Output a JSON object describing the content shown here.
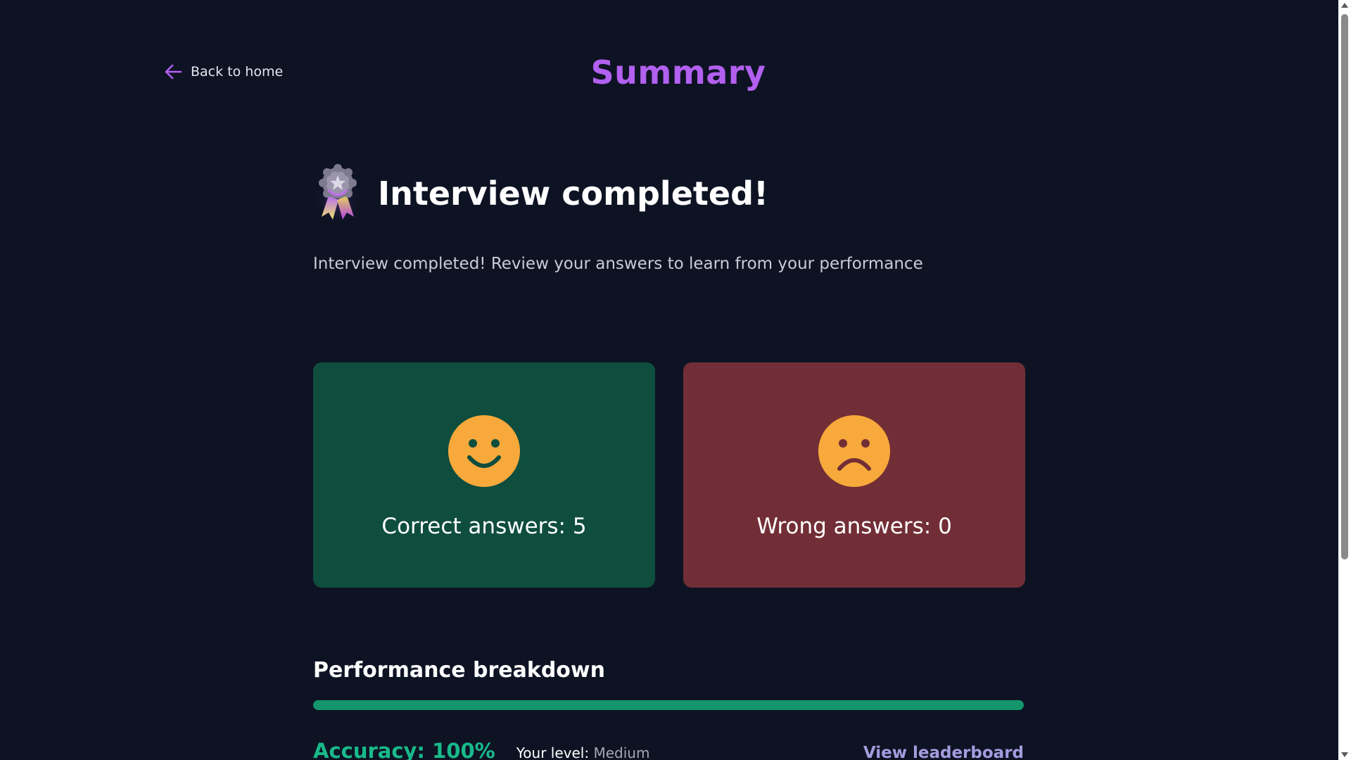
{
  "header": {
    "back_label": "Back to home",
    "title": "Summary"
  },
  "hero": {
    "title": "Interview completed!",
    "subtitle": "Interview completed! Review your answers to learn from your performance",
    "badge_icon": "medal-badge-icon"
  },
  "cards": {
    "correct": {
      "label": "Correct answers: 5",
      "icon": "smiley-face-icon",
      "background": "#0f4d3e"
    },
    "wrong": {
      "label": "Wrong answers: 0",
      "icon": "sad-face-icon",
      "background": "#722e36"
    }
  },
  "performance": {
    "title": "Performance breakdown",
    "progress_fraction": 1.0,
    "accuracy_label": "Accuracy: 100%",
    "level_prefix": "Your level:",
    "level_value": "Medium",
    "leaderboard_label": "View leaderboard"
  },
  "colors": {
    "background": "#0e1324",
    "accent_purple": "#b260f0",
    "success": "#19b98a",
    "progress": "#13966b",
    "link": "#a59bdf",
    "emoji_yellow": "#f7a93b"
  }
}
